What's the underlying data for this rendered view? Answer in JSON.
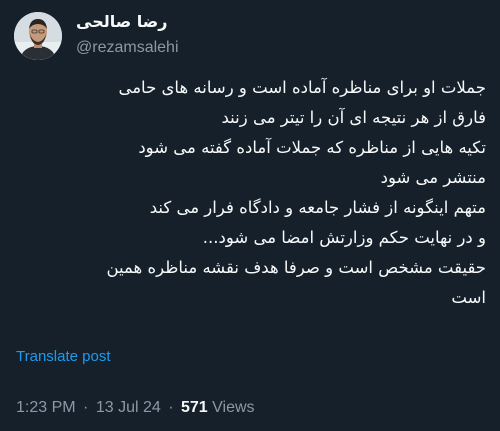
{
  "author": {
    "display_name": "رضا صالحی",
    "handle": "@rezamsalehi"
  },
  "post": {
    "lines": [
      "جملات او برای مناظره آماده است و رسانه های حامی",
      "فارق از هر نتیجه ای آن را تیتر می زنند",
      "تکیه هایی از مناظره که جملات آماده گفته می شود",
      "منتشر می شود",
      "متهم اینگونه از فشار جامعه و دادگاه فرار می کند",
      "و در نهایت حکم وزارتش امضا می شود...",
      "حقیقت مشخص است و صرفا هدف نقشه مناظره همین",
      "است"
    ],
    "translate_label": "Translate post"
  },
  "meta": {
    "time": "1:23 PM",
    "separator": "·",
    "date": "13 Jul 24",
    "views_count": "571",
    "views_label": "Views"
  },
  "colors": {
    "background": "#15202b",
    "text": "#f7f9f9",
    "secondary": "#8b98a5",
    "link": "#1d9bf0"
  }
}
